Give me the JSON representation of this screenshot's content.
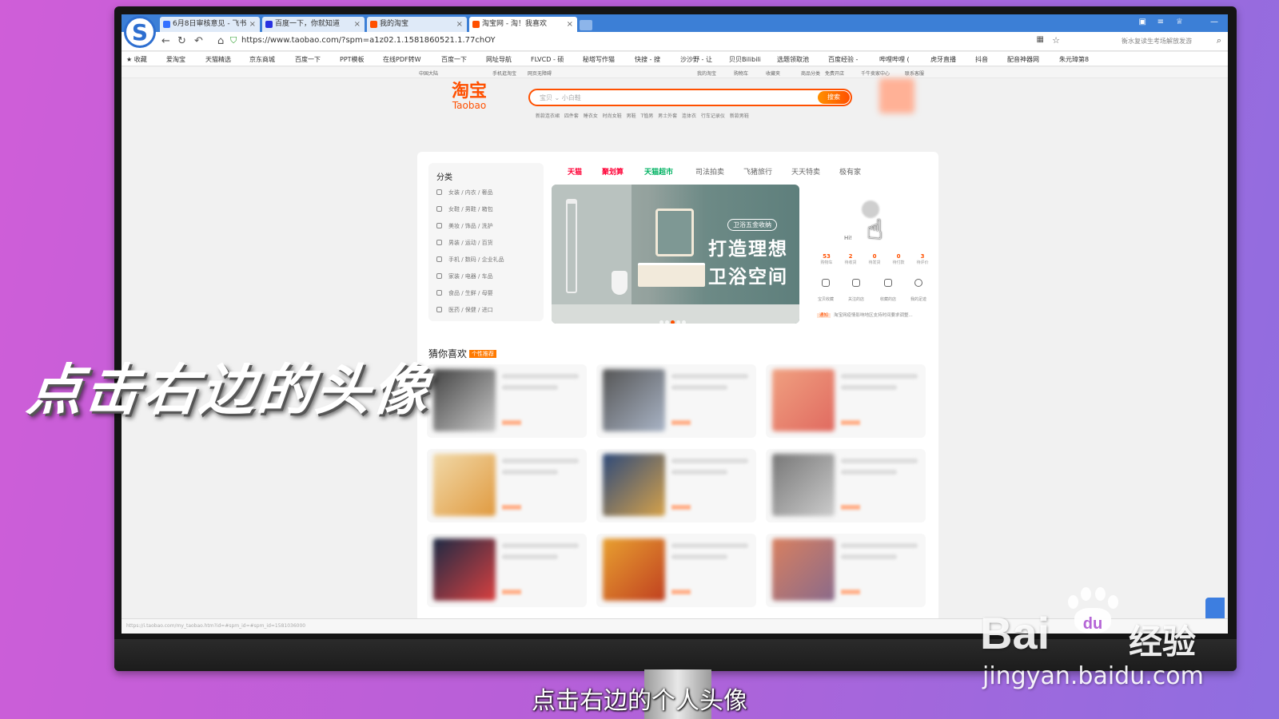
{
  "browser": {
    "logo": "S",
    "tabs": [
      {
        "label": "6月8日审核意见 - 飞书",
        "active": false
      },
      {
        "label": "百度一下，你就知道",
        "active": false
      },
      {
        "label": "我的淘宝",
        "active": false
      },
      {
        "label": "淘宝网 - 淘！我喜欢",
        "active": true
      }
    ],
    "url": "https://www.taobao.com/?spm=a1z02.1.1581860521.1.77chOY",
    "address_right": "衡水复读生考场解放发游",
    "bookmarks": [
      "收藏",
      "爱淘宝",
      "天猫精选",
      "京东商城",
      "百度一下",
      "PPT模板",
      "在线PDF转W",
      "百度一下",
      "网址导航",
      "FLVCD - 硕",
      "秘塔写作猫",
      "快搜 - 搜",
      "沙沙野 - 让",
      "贝贝Bilibili",
      "选题领取池",
      "百度经验 -",
      "哔哩哔哩 (",
      "虎牙直播",
      "抖音",
      "配音神器网",
      "朱元璋第8"
    ]
  },
  "taobao": {
    "site_nav": [
      "中国大陆",
      "手机逛淘宝",
      "网页无障碍",
      "我的淘宝",
      "购物车",
      "收藏夹",
      "商品分类",
      "免费开店",
      "千牛卖家中心",
      "联系客服"
    ],
    "logo_cn": "淘宝",
    "logo_en": "Taobao",
    "search_placeholder": "宝贝 ⌄  小白鞋",
    "search_button": "搜索",
    "hot_words": "新款连衣裙 四件套 睡衣女 时尚女鞋 男鞋 T恤男 男士外套 连体衣 行车记录仪 新款男鞋",
    "category_title": "分类",
    "categories": [
      "女装 / 内衣 / 奢品",
      "女鞋 / 男鞋 / 箱包",
      "美妆 / 饰品 / 洗护",
      "男装 / 运动 / 百货",
      "手机 / 数码 / 企业礼品",
      "家装 / 电器 / 车品",
      "食品 / 生鲜 / 母婴",
      "医药 / 保健 / 进口"
    ],
    "channels": [
      "天猫",
      "聚划算",
      "天猫超市",
      "司法拍卖",
      "飞猪旅行",
      "天天特卖",
      "极有家"
    ],
    "banner": {
      "tag": "卫浴五金收纳",
      "line1": "打造理想",
      "line2": "卫浴空间"
    },
    "user": {
      "greeting": "Hi!",
      "stats": [
        {
          "num": "53",
          "label": "购物车"
        },
        {
          "num": "2",
          "label": "待收货"
        },
        {
          "num": "0",
          "label": "待发货"
        },
        {
          "num": "0",
          "label": "待付款"
        },
        {
          "num": "3",
          "label": "待评价"
        }
      ],
      "tools": [
        "宝贝收藏",
        "关注的店",
        "收藏的店",
        "我的足迹"
      ],
      "notice_tag": "通知",
      "notice": "淘宝网疫情影响地区支持时间要求调整..."
    },
    "guess_title": "猜你喜欢",
    "guess_badge": "个性推荐",
    "status_url": "https://i.taobao.com/my_taobao.htm?id=#spm_id=#spm_id=1581036000"
  },
  "overlay": {
    "caption": "点击右边的头像",
    "subtitle": "点击右边的个人头像",
    "watermark": "Bai",
    "watermark_paw": "du",
    "watermark_cn": "经验",
    "watermark_url": "jingyan.baidu.com"
  }
}
